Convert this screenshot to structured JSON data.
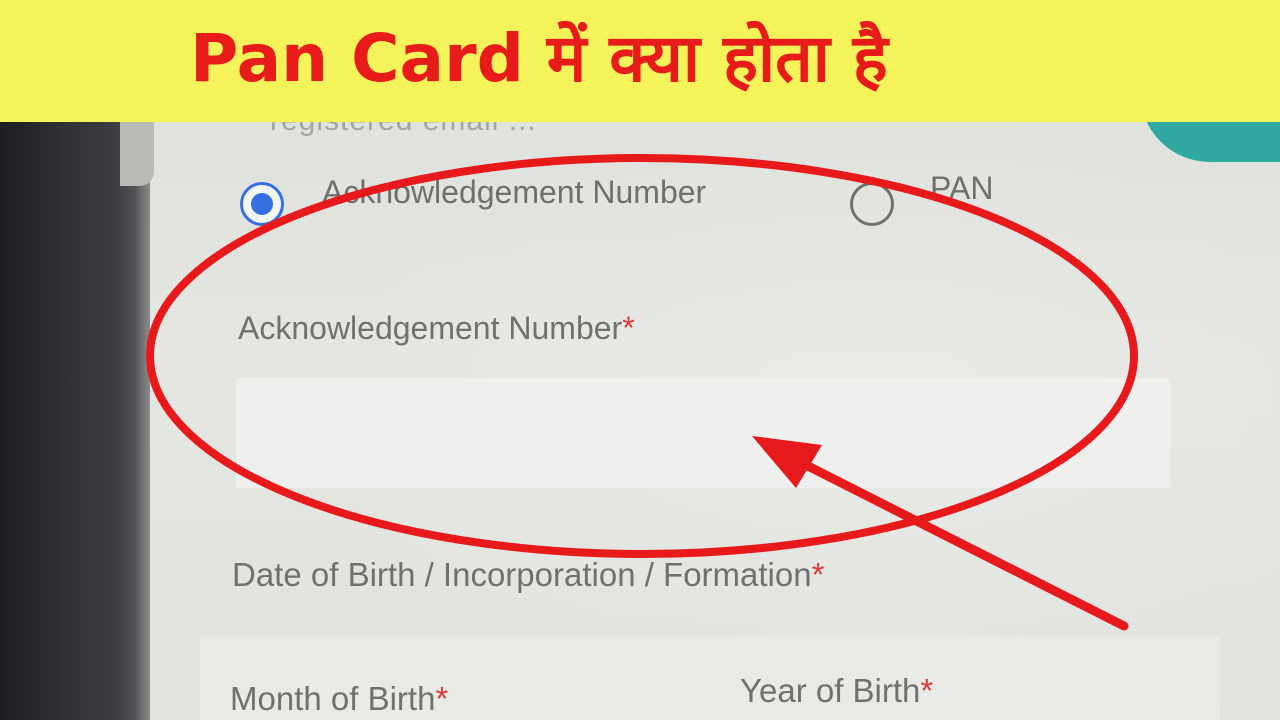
{
  "banner": {
    "title": "Pan Card में क्या होता है"
  },
  "form": {
    "cut_off_text": "registered email ...",
    "id_type_options": [
      {
        "label": "Acknowledgement Number",
        "selected": true
      },
      {
        "label": "PAN",
        "selected": false
      }
    ],
    "acknowledgement_field": {
      "label": "Acknowledgement Number",
      "required_mark": "*",
      "value": ""
    },
    "dob_field": {
      "label": "Date of Birth / Incorporation / Formation",
      "required_mark": "*"
    },
    "month_field": {
      "label": "Month of Birth",
      "required_mark": "*"
    },
    "year_field": {
      "label": "Year of Birth",
      "required_mark": "*"
    }
  },
  "annotation": {
    "color": "#e8191b",
    "shapes": [
      "highlight-ellipse",
      "pointer-arrow"
    ]
  }
}
